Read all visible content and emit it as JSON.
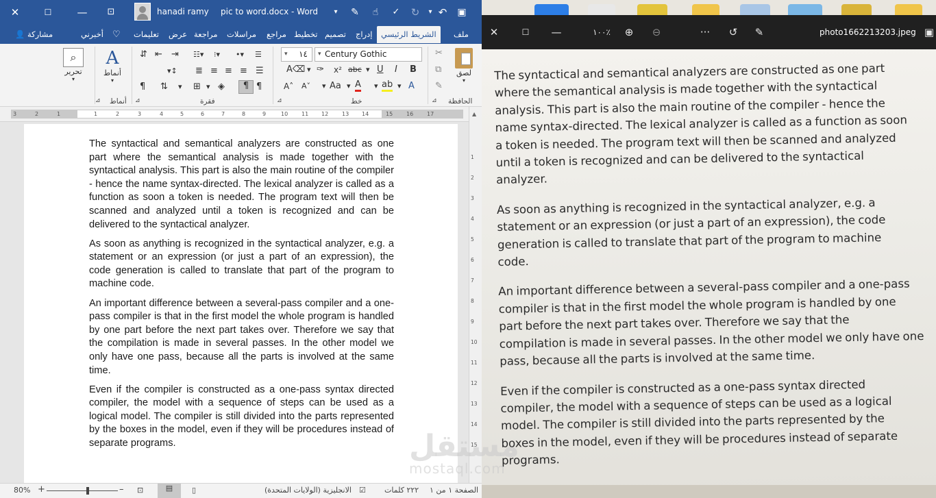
{
  "word": {
    "titlebar": {
      "user_name": "hanadi ramy",
      "doc_title": "pic to word.docx - Word",
      "icons": [
        "close-icon",
        "restore-icon",
        "minimize-icon",
        "ribbon-display-icon",
        "save-icon",
        "redo-icon",
        "undo-icon",
        "customize-icon"
      ]
    },
    "tabs": {
      "file": "ملف",
      "home": "الشريط الرئيسي",
      "insert": "إدراج",
      "design": "تصميم",
      "layout": "تخطيط",
      "references": "مراجع",
      "mailings": "مراسلات",
      "review": "مراجعة",
      "view": "عرض",
      "help": "تعليمات",
      "tell_me": "أخبرني",
      "share": "مشاركة"
    },
    "ribbon": {
      "clipboard_label": "الحافظة",
      "paste_label": "لصق",
      "font_label": "خط",
      "paragraph_label": "فقرة",
      "styles_label": "أنماط",
      "styles_button": "أنماط",
      "editing_button": "تحرير",
      "font_name": "Century Gothic",
      "font_size": "١٤"
    },
    "ruler_numbers": [
      "3",
      "2",
      "1",
      "1",
      "2",
      "3",
      "4",
      "5",
      "6",
      "7",
      "8",
      "9",
      "10",
      "11",
      "12",
      "13",
      "14",
      "15",
      "16",
      "17"
    ],
    "document": {
      "paragraphs": [
        "The syntactical and semantical analyzers are constructed as one part where the semantical analysis is made together with the syntactical analysis. This part is also the main routine of the compiler - hence the name syntax-directed. The lexical analyzer is called as a function as soon a token is needed. The program text will then be scanned and analyzed until a token is recognized and can be delivered to the syntactical analyzer.",
        " As soon as anything is recognized in the syntactical analyzer, e.g. a statement or an expression (or just a part of an expression), the code generation is called to translate that part of the program to machine code.",
        "An important difference between a several-pass compiler and a one-pass compiler is that in the first model the whole program is handled by one part before the next part takes over. Therefore we say that the compilation is made in several passes. In the other model we only have one pass, because all the parts is involved at the same time.",
        " Even if the compiler is constructed as a one-pass syntax directed compiler, the model with a sequence of steps can be used as a logical model. The compiler is still divided into the parts represented by the boxes in the model, even if they will be procedures instead of separate programs."
      ]
    },
    "statusbar": {
      "page": "الصفحة ١ من ١",
      "words": "٢٢٢ كلمات",
      "language": "الانجليزية (الولايات المتحدة)",
      "zoom": "80%"
    }
  },
  "viewer": {
    "zoom": "١٠٠٪",
    "filename": "photo1662213203.jpeg",
    "handwritten_paragraphs": [
      [
        "The syntactical and semantical analyzers are constructed as one part",
        "where the semantical analysis is made together with the syntactical",
        "analysis. This part is also the main routine of the compiler - hence the",
        "name syntax-directed. The lexical analyzer is called as a function as soon",
        "a token is needed. The program text will then be scanned and analyzed",
        "until a token is recognized and can be delivered to the syntactical",
        "analyzer."
      ],
      [
        "As soon as anything is recognized in the syntactical analyzer, e.g. a",
        "statement or an expression (or just a part of an expression), the code",
        "generation is called to translate that part of the program to machine",
        "code."
      ],
      [
        "An important difference between a several-pass compiler and a one-pass",
        "compiler is that in the first model the whole program is handled by one",
        "part before the next part takes over. Therefore we say that the",
        "compilation is made in several passes. In the other model we only have one",
        "pass, because all the parts is involved at the same time."
      ],
      [
        "Even if the compiler is constructed as a one-pass syntax directed",
        "compiler, the model with a sequence of steps can be used as a logical",
        "model. The compiler is still divided into the parts represented by the",
        "boxes in the model, even if they will be procedures instead of separate",
        "programs."
      ]
    ]
  },
  "watermark": {
    "line1": "مستقل",
    "line2": "mostaql.com"
  }
}
